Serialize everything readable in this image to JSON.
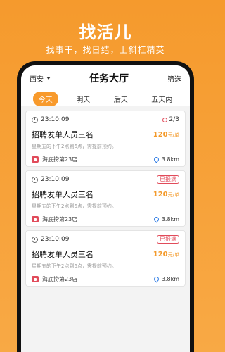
{
  "promo": {
    "title": "找活儿",
    "subtitle": "找事干，找日结，上斜杠精英"
  },
  "app": {
    "city": "西安",
    "title": "任务大厅",
    "filter": "筛选"
  },
  "tabs": [
    {
      "label": "今天",
      "active": true
    },
    {
      "label": "明天",
      "active": false
    },
    {
      "label": "后天",
      "active": false
    },
    {
      "label": "五天内",
      "active": false
    }
  ],
  "tasks": [
    {
      "time": "23:10:09",
      "status": "2/3",
      "title": "招聘发单人员三名",
      "price": "120",
      "price_unit": "元/单",
      "description": "星期五的下午2点到6点，需提前预约。",
      "shop": "海底捞第23店",
      "distance": "3.8km"
    },
    {
      "time": "23:10:09",
      "status": "已报满",
      "title": "招聘发单人员三名",
      "price": "120",
      "price_unit": "元/单",
      "description": "星期五的下午2点到6点，需提前预约。",
      "shop": "海底捞第23店",
      "distance": "3.8km"
    },
    {
      "time": "23:10:09",
      "status": "已报满",
      "title": "招聘发单人员三名",
      "price": "120",
      "price_unit": "元/单",
      "description": "星期五的下午2点到6点，需提前预约。",
      "shop": "海底捞第23店",
      "distance": "3.8km"
    }
  ],
  "colors": {
    "accent": "#f89a2c",
    "danger": "#e14b5a",
    "location": "#2d7be5"
  },
  "icons": {
    "clock": "clock-icon",
    "user": "user-icon",
    "shop": "shop-icon",
    "location": "location-pin-icon",
    "caret": "chevron-down-icon"
  }
}
